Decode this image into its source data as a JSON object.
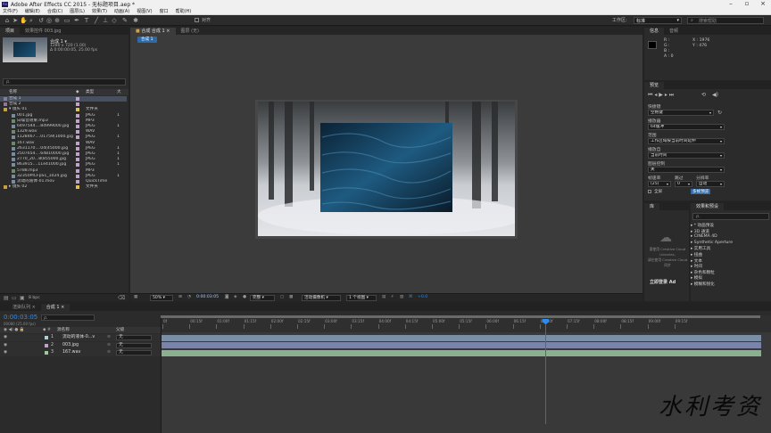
{
  "window": {
    "title": "Adobe After Effects CC 2015 - 无标题项目.aep *"
  },
  "menu": [
    "文件(F)",
    "编辑(E)",
    "合成(C)",
    "图层(L)",
    "效果(T)",
    "动画(A)",
    "视图(V)",
    "窗口",
    "帮助(H)"
  ],
  "toolbar": {
    "snap_label": "对齐",
    "workspace_label": "工作区:",
    "workspace_value": "标准",
    "search_placeholder": "搜索帮助"
  },
  "project": {
    "tab_project": "项目",
    "tab_effects": "效果控件 003.jpg",
    "comp_name": "合成 1 ▾",
    "comp_info1": "1280 x 720 (1.00)",
    "comp_info2": "Δ 0:00:00:05, 25.00 fps",
    "search_placeholder": "ρ.",
    "col_name": "名称",
    "col_type": "类型",
    "col_size": "大",
    "rows": [
      {
        "name": "合成 1",
        "type": "",
        "size": "",
        "level": 0,
        "color": "#bda4c8",
        "icon": "comp",
        "sel": true
      },
      {
        "name": "合成 2",
        "type": "",
        "size": "",
        "level": 0,
        "color": "#bda4c8",
        "icon": "comp"
      },
      {
        "name": "▾ 镜头 01",
        "type": "文件夹",
        "size": "",
        "level": 0,
        "color": "#e0c050",
        "icon": "folder"
      },
      {
        "name": "001.jpg",
        "type": "JPEG",
        "size": "1",
        "level": 1,
        "color": "#bda4c8",
        "icon": "img"
      },
      {
        "name": "白噪音效果.mp3",
        "type": "MP3",
        "size": "",
        "level": 1,
        "color": "#bda4c8",
        "icon": "audio"
      },
      {
        "name": "6497544....84999000.jpg",
        "type": "JPEG",
        "size": "1",
        "level": 1,
        "color": "#bda4c8",
        "icon": "img"
      },
      {
        "name": "1329.wav",
        "type": "WAV",
        "size": "",
        "level": 1,
        "color": "#bda4c8",
        "icon": "audio"
      },
      {
        "name": "1128467....01759(1000.jpg",
        "type": "JPEG",
        "size": "1",
        "level": 1,
        "color": "#bda4c8",
        "icon": "img"
      },
      {
        "name": "167.wav",
        "type": "WAV",
        "size": "",
        "level": 1,
        "color": "#bda4c8",
        "icon": "audio"
      },
      {
        "name": "2631170....04(45000.jpg",
        "type": "JPEG",
        "size": "1",
        "level": 1,
        "color": "#bda4c8",
        "icon": "img"
      },
      {
        "name": "2507654....64810000.jpg",
        "type": "JPEG",
        "size": "1",
        "level": 1,
        "color": "#bda4c8",
        "icon": "img"
      },
      {
        "name": "2770_20...8(855000.jpg",
        "type": "JPEG",
        "size": "1",
        "level": 1,
        "color": "#bda4c8",
        "icon": "img"
      },
      {
        "name": "863915....11e41000.jpg",
        "type": "JPEG",
        "size": "1",
        "level": 1,
        "color": "#bda4c8",
        "icon": "img"
      },
      {
        "name": "5788.mp3",
        "type": "MP3",
        "size": "",
        "level": 1,
        "color": "#bda4c8",
        "icon": "audio"
      },
      {
        "name": "32350PICFpS1_1024.jpg",
        "type": "JPEG",
        "size": "1",
        "level": 1,
        "color": "#bda4c8",
        "icon": "img"
      },
      {
        "name": "流动的液体-01.mov",
        "type": "QuickTime",
        "size": "",
        "level": 1,
        "color": "#bda4c8",
        "icon": "video"
      },
      {
        "name": "▸ 镜头 02",
        "type": "文件夹",
        "size": "",
        "level": 0,
        "color": "#e0c050",
        "icon": "folder"
      }
    ],
    "bpc": "8 bpc"
  },
  "comp_viewer": {
    "tab_label": "合成 合成 1",
    "tab_layer": "图层 (无)",
    "breadcrumb": "合成 1",
    "zoom": "50%",
    "timecode": "0:00:03:05",
    "resolution": "完整",
    "camera": "活动摄像机",
    "views": "1 个视图",
    "offset": "+0.0"
  },
  "info": {
    "tab_info": "信息",
    "tab_audio": "音频",
    "x": "X : 1976",
    "y": "Y : 476",
    "r": "R :",
    "g": "G :",
    "b": "B :",
    "a": "A : 0"
  },
  "preview": {
    "tab": "预览",
    "shortcut_label": "快捷键",
    "shortcut_value": "空格键",
    "include_label": "播放器",
    "include_value": "64缓冲",
    "range_label": "范围",
    "range_value": "工作区域按当前时间延伸",
    "play_from_label": "播放自",
    "play_from_value": "当前时间",
    "fullscreen_label": "图层控制",
    "fullscreen_value": "关",
    "fps_label": "帧速率",
    "fps_value": "(25)",
    "skip_label": "跳过",
    "skip_value": "0",
    "res_label": "分辨率",
    "res_value": "自动",
    "fullscreen_check": "全屏",
    "cache_label": "多帧预览"
  },
  "library": {
    "tab": "库",
    "text1": "要使用 Creative Cloud",
    "text2": "Libraries,",
    "text3": "请在使用 Creative Cloud",
    "text4": "同步",
    "button": "立即登录 Ad"
  },
  "effects": {
    "tab": "效果和预设",
    "items": [
      "* 动画预设",
      "3D 通道",
      "CINEMA 4D",
      "Synthetic Aperture",
      "实用工具",
      "扭曲",
      "文本",
      "时间",
      "杂色和颗粒",
      "模拟",
      "模糊和锐化"
    ]
  },
  "timeline": {
    "tab_render": "渲染队列",
    "tab_comp": "合成 1",
    "timecode": "0:00:03:05",
    "frame_info": "00080 (25.00 fps)",
    "col_source": "源名称",
    "col_mode": "父级",
    "ticks": [
      "0f",
      "00:15f",
      "01:00f",
      "01:15f",
      "02:00f",
      "02:15f",
      "03:00f",
      "03:15f",
      "04:00f",
      "04:15f",
      "05:00f",
      "05:15f",
      "06:00f",
      "06:15f",
      "07:00f",
      "07:15f",
      "08:00f",
      "08:15f",
      "09:00f",
      "09:15f"
    ],
    "layers": [
      {
        "num": "1",
        "name": "流动的液体-0...v",
        "parent": "无",
        "color": "#a7d0e0",
        "bar": "#7a8ea6"
      },
      {
        "num": "2",
        "name": "003.jpg",
        "parent": "无",
        "color": "#bda4c8",
        "bar": "#7a84a8"
      },
      {
        "num": "3",
        "name": "167.wav",
        "parent": "无",
        "color": "#a0c8a0",
        "bar": "#8ab090"
      }
    ]
  },
  "watermark": "水利考资",
  "colors": {
    "accent": "#2d8ceb",
    "playhead": "#e03030"
  }
}
